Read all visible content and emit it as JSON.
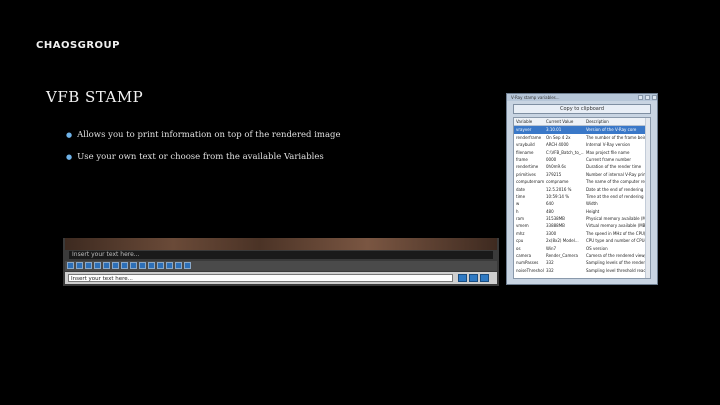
{
  "logo": "CHAOSGROUP",
  "title": "VFB STAMP",
  "bullets": [
    "Allows you to print information on top of the rendered image",
    "Use your own text or choose from the available Variables"
  ],
  "vfb": {
    "overlay_text": "Insert your text here...",
    "input_text": "Insert your text here..."
  },
  "dialog": {
    "title": "V-Ray stamp variables...",
    "copy_button": "Copy to clipboard",
    "columns": [
      "Variable",
      "Current Value",
      "Description"
    ],
    "rows": [
      [
        "vrayver",
        "3.10.01",
        "Version of the V-Ray core"
      ],
      [
        "renderframe",
        "On Sep 4 2x",
        "The number of the frame being rendered"
      ],
      [
        "vraybuild",
        "ARCH 4000",
        "Internal V-Ray version"
      ],
      [
        "filename",
        "C:\\VFB_Batch_to_...",
        "Max project file name"
      ],
      [
        "frame",
        "0000",
        "Current frame number"
      ],
      [
        "rendertime",
        "0h0m9.6s",
        "Duration of the render time"
      ],
      [
        "primitives",
        "379215",
        "Number of internal V-Ray primitives"
      ],
      [
        "computername",
        "compname",
        "The name of the computer rendering"
      ],
      [
        "date",
        "12.5.2016 %",
        "Date at the end of rendering"
      ],
      [
        "time",
        "10:59:14 %",
        "Time at the end of rendering"
      ],
      [
        "w",
        "640",
        "Width"
      ],
      [
        "h",
        "480",
        "Height"
      ],
      [
        "ram",
        "31538MB",
        "Physical memory available (MB)"
      ],
      [
        "vmem",
        "33888MB",
        "Virtual memory available (MB)"
      ],
      [
        "mhz",
        "3300",
        "The speed in MHz of the CPU(s)"
      ],
      [
        "cpu",
        "2x(8x2) Model...",
        "CPU type and number of CPUs"
      ],
      [
        "os",
        "Win7",
        "OS version"
      ],
      [
        "camera",
        "Render_Camera",
        "Camera of the rendered viewport"
      ],
      [
        "numPasses",
        "332",
        "Sampling levels of the render"
      ],
      [
        "noiseThreshold",
        "332",
        "Sampling level threshold reached"
      ]
    ]
  }
}
